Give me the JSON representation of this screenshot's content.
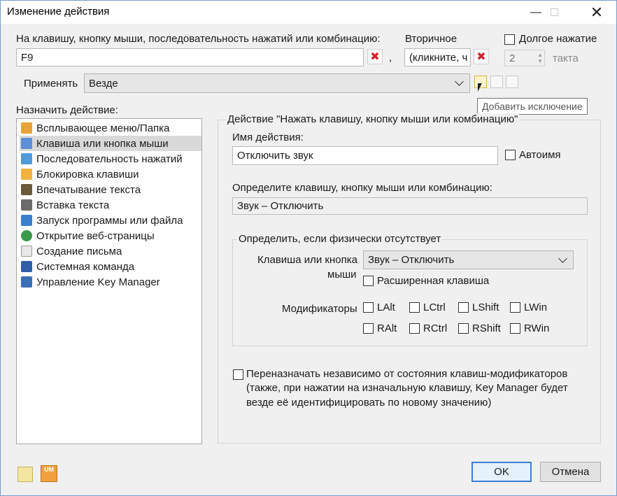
{
  "window": {
    "title": "Изменение действия"
  },
  "top": {
    "key_label": "На клавишу, кнопку мыши, последовательность нажатий или комбинацию:",
    "key_value": "F9",
    "comma": ",",
    "secondary_label": "Вторичное",
    "secondary_value": "(кликните, ч",
    "long_press_label": "Долгое нажатие",
    "long_press_value": "2",
    "tact_label": "такта"
  },
  "apply": {
    "label": "Применять",
    "value": "Везде",
    "tooltip": "Добавить исключение"
  },
  "assign": {
    "label": "Назначить действие:",
    "items": [
      {
        "label": "Всплывающее меню/Папка",
        "icon": "menu-folder-icon",
        "color": "#e8a23a"
      },
      {
        "label": "Клавиша или кнопка мыши",
        "icon": "key-mouse-icon",
        "color": "#5b8fd6",
        "selected": true
      },
      {
        "label": "Последовательность нажатий",
        "icon": "sequence-icon",
        "color": "#4f9bd8"
      },
      {
        "label": "Блокировка клавиши",
        "icon": "lock-key-icon",
        "color": "#f0b23e"
      },
      {
        "label": "Впечатывание текста",
        "icon": "type-text-icon",
        "color": "#6b5a3a"
      },
      {
        "label": "Вставка текста",
        "icon": "paste-text-icon",
        "color": "#6b6b6b"
      },
      {
        "label": "Запуск программы или файла",
        "icon": "run-program-icon",
        "color": "#3a7fc9"
      },
      {
        "label": "Открытие веб-страницы",
        "icon": "web-page-icon",
        "color": "#3b9a4a"
      },
      {
        "label": "Создание письма",
        "icon": "mail-icon",
        "color": "#9a9a9a"
      },
      {
        "label": "Системная команда",
        "icon": "system-command-icon",
        "color": "#2f5ea8"
      },
      {
        "label": "Управление Key Manager",
        "icon": "key-manager-icon",
        "color": "#3a6fb5"
      }
    ]
  },
  "action": {
    "group_title": "Действие \"Нажать клавишу, кнопку мыши или комбинацию\"",
    "name_label": "Имя действия:",
    "name_value": "Отключить звук",
    "autoname_label": "Автоимя",
    "define_label": "Определите клавишу, кнопку мыши или комбинацию:",
    "define_value": "Звук – Отключить",
    "physical_group": "Определить, если физически отсутствует",
    "key_or_button_label_1": "Клавиша или кнопка",
    "key_or_button_label_2": "мыши",
    "key_or_button_value": "Звук – Отключить",
    "extended_label": "Расширенная клавиша",
    "modifiers_label": "Модификаторы",
    "modifiers_row1": [
      "LAlt",
      "LCtrl",
      "LShift",
      "LWin"
    ],
    "modifiers_row2": [
      "RAlt",
      "RCtrl",
      "RShift",
      "RWin"
    ],
    "reassign_line1": "Переназначать независимо от состояния клавиш-модификаторов",
    "reassign_line2": "(также, при нажатии на изначальную клавишу, Key Manager будет",
    "reassign_line3": "везде её идентифицировать по новому значению)"
  },
  "buttons": {
    "ok": "OK",
    "cancel": "Отмена"
  },
  "colors": {
    "accent": "#3c7fd1",
    "delete": "#d3232a"
  }
}
